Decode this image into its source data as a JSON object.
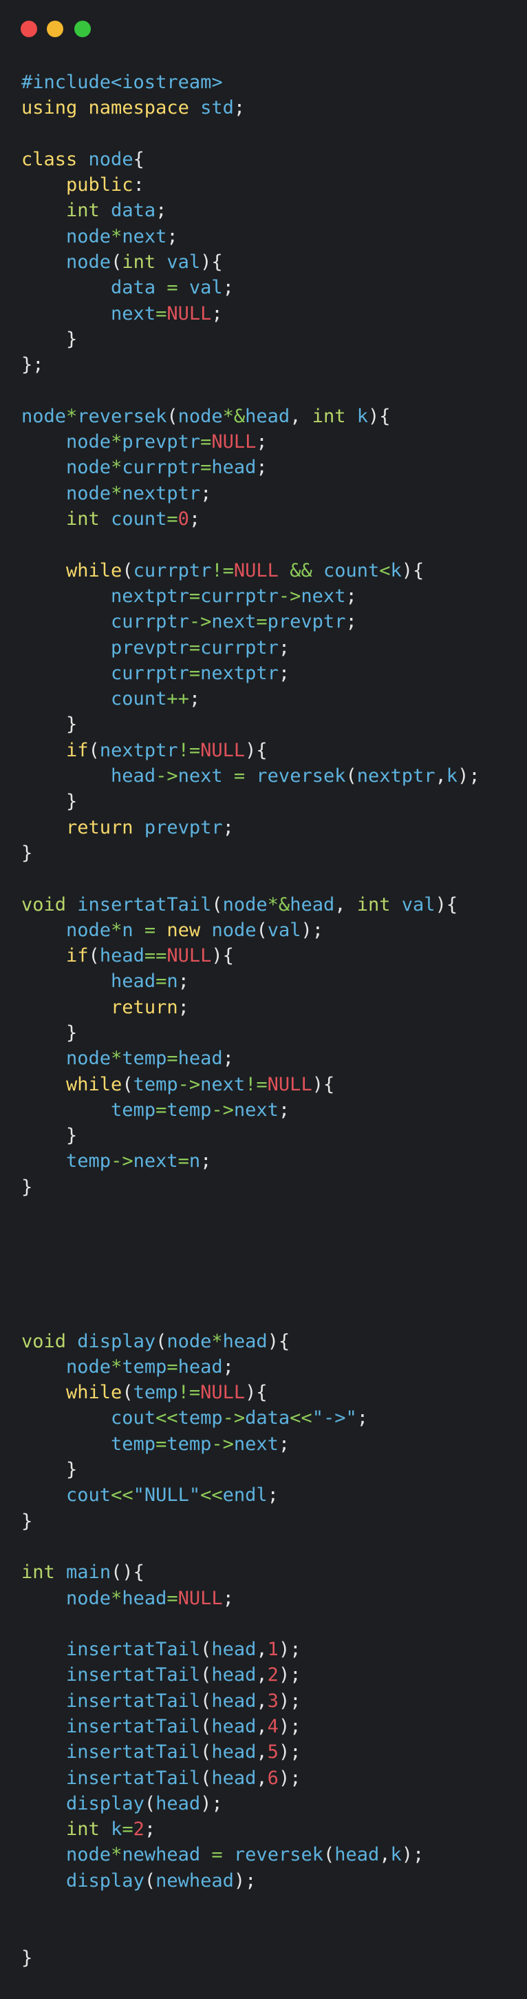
{
  "window": {
    "controls": [
      {
        "name": "close",
        "color": "#ef4b4b"
      },
      {
        "name": "minimize",
        "color": "#f3b82f"
      },
      {
        "name": "maximize",
        "color": "#37c53e"
      }
    ]
  },
  "colors": {
    "background": "#1c1e21",
    "plain": "#e6e6e6",
    "keyword": "#f6d86b",
    "type": "#b8d66a",
    "ident": "#5eb3e0",
    "operator": "#8ecb5a",
    "number": "#e0525a",
    "null": "#e0525a",
    "preprocessor": "#5eb3e0",
    "string": "#5eb3e0"
  },
  "code_lines": [
    [
      [
        "pp",
        "#include<iostream>"
      ]
    ],
    [
      [
        "kw",
        "using namespace"
      ],
      [
        "pl",
        " "
      ],
      [
        "id",
        "std"
      ],
      [
        "pl",
        ";"
      ]
    ],
    [],
    [
      [
        "kw",
        "class"
      ],
      [
        "pl",
        " "
      ],
      [
        "id",
        "node"
      ],
      [
        "pl",
        "{"
      ]
    ],
    [
      [
        "pl",
        "    "
      ],
      [
        "kw",
        "public"
      ],
      [
        "pl",
        ":"
      ]
    ],
    [
      [
        "pl",
        "    "
      ],
      [
        "ty",
        "int"
      ],
      [
        "pl",
        " "
      ],
      [
        "id",
        "data"
      ],
      [
        "pl",
        ";"
      ]
    ],
    [
      [
        "pl",
        "    "
      ],
      [
        "id",
        "node"
      ],
      [
        "op",
        "*"
      ],
      [
        "id",
        "next"
      ],
      [
        "pl",
        ";"
      ]
    ],
    [
      [
        "pl",
        "    "
      ],
      [
        "id",
        "node"
      ],
      [
        "pl",
        "("
      ],
      [
        "ty",
        "int"
      ],
      [
        "pl",
        " "
      ],
      [
        "id",
        "val"
      ],
      [
        "pl",
        "){"
      ]
    ],
    [
      [
        "pl",
        "        "
      ],
      [
        "id",
        "data"
      ],
      [
        "pl",
        " "
      ],
      [
        "op",
        "="
      ],
      [
        "pl",
        " "
      ],
      [
        "id",
        "val"
      ],
      [
        "pl",
        ";"
      ]
    ],
    [
      [
        "pl",
        "        "
      ],
      [
        "id",
        "next"
      ],
      [
        "op",
        "="
      ],
      [
        "nu",
        "NULL"
      ],
      [
        "pl",
        ";"
      ]
    ],
    [
      [
        "pl",
        "    }"
      ]
    ],
    [
      [
        "pl",
        "};"
      ]
    ],
    [],
    [
      [
        "id",
        "node"
      ],
      [
        "op",
        "*"
      ],
      [
        "id",
        "reversek"
      ],
      [
        "pl",
        "("
      ],
      [
        "id",
        "node"
      ],
      [
        "op",
        "*&"
      ],
      [
        "id",
        "head"
      ],
      [
        "pl",
        ", "
      ],
      [
        "ty",
        "int"
      ],
      [
        "pl",
        " "
      ],
      [
        "id",
        "k"
      ],
      [
        "pl",
        "){"
      ]
    ],
    [
      [
        "pl",
        "    "
      ],
      [
        "id",
        "node"
      ],
      [
        "op",
        "*"
      ],
      [
        "id",
        "prevptr"
      ],
      [
        "op",
        "="
      ],
      [
        "nu",
        "NULL"
      ],
      [
        "pl",
        ";"
      ]
    ],
    [
      [
        "pl",
        "    "
      ],
      [
        "id",
        "node"
      ],
      [
        "op",
        "*"
      ],
      [
        "id",
        "currptr"
      ],
      [
        "op",
        "="
      ],
      [
        "id",
        "head"
      ],
      [
        "pl",
        ";"
      ]
    ],
    [
      [
        "pl",
        "    "
      ],
      [
        "id",
        "node"
      ],
      [
        "op",
        "*"
      ],
      [
        "id",
        "nextptr"
      ],
      [
        "pl",
        ";"
      ]
    ],
    [
      [
        "pl",
        "    "
      ],
      [
        "ty",
        "int"
      ],
      [
        "pl",
        " "
      ],
      [
        "id",
        "count"
      ],
      [
        "op",
        "="
      ],
      [
        "nu",
        "0"
      ],
      [
        "pl",
        ";"
      ]
    ],
    [],
    [
      [
        "pl",
        "    "
      ],
      [
        "kw",
        "while"
      ],
      [
        "pl",
        "("
      ],
      [
        "id",
        "currptr"
      ],
      [
        "op",
        "!="
      ],
      [
        "nu",
        "NULL"
      ],
      [
        "pl",
        " "
      ],
      [
        "op",
        "&&"
      ],
      [
        "pl",
        " "
      ],
      [
        "id",
        "count"
      ],
      [
        "op",
        "<"
      ],
      [
        "id",
        "k"
      ],
      [
        "pl",
        "){"
      ]
    ],
    [
      [
        "pl",
        "        "
      ],
      [
        "id",
        "nextptr"
      ],
      [
        "op",
        "="
      ],
      [
        "id",
        "currptr"
      ],
      [
        "op",
        "->"
      ],
      [
        "id",
        "next"
      ],
      [
        "pl",
        ";"
      ]
    ],
    [
      [
        "pl",
        "        "
      ],
      [
        "id",
        "currptr"
      ],
      [
        "op",
        "->"
      ],
      [
        "id",
        "next"
      ],
      [
        "op",
        "="
      ],
      [
        "id",
        "prevptr"
      ],
      [
        "pl",
        ";"
      ]
    ],
    [
      [
        "pl",
        "        "
      ],
      [
        "id",
        "prevptr"
      ],
      [
        "op",
        "="
      ],
      [
        "id",
        "currptr"
      ],
      [
        "pl",
        ";"
      ]
    ],
    [
      [
        "pl",
        "        "
      ],
      [
        "id",
        "currptr"
      ],
      [
        "op",
        "="
      ],
      [
        "id",
        "nextptr"
      ],
      [
        "pl",
        ";"
      ]
    ],
    [
      [
        "pl",
        "        "
      ],
      [
        "id",
        "count"
      ],
      [
        "op",
        "++"
      ],
      [
        "pl",
        ";"
      ]
    ],
    [
      [
        "pl",
        "    }"
      ]
    ],
    [
      [
        "pl",
        "    "
      ],
      [
        "kw",
        "if"
      ],
      [
        "pl",
        "("
      ],
      [
        "id",
        "nextptr"
      ],
      [
        "op",
        "!="
      ],
      [
        "nu",
        "NULL"
      ],
      [
        "pl",
        "){"
      ]
    ],
    [
      [
        "pl",
        "        "
      ],
      [
        "id",
        "head"
      ],
      [
        "op",
        "->"
      ],
      [
        "id",
        "next"
      ],
      [
        "pl",
        " "
      ],
      [
        "op",
        "="
      ],
      [
        "pl",
        " "
      ],
      [
        "id",
        "reversek"
      ],
      [
        "pl",
        "("
      ],
      [
        "id",
        "nextptr"
      ],
      [
        "pl",
        ","
      ],
      [
        "id",
        "k"
      ],
      [
        "pl",
        ");"
      ]
    ],
    [
      [
        "pl",
        "    }"
      ]
    ],
    [
      [
        "pl",
        "    "
      ],
      [
        "kw",
        "return"
      ],
      [
        "pl",
        " "
      ],
      [
        "id",
        "prevptr"
      ],
      [
        "pl",
        ";"
      ]
    ],
    [
      [
        "pl",
        "}"
      ]
    ],
    [],
    [
      [
        "ty",
        "void"
      ],
      [
        "pl",
        " "
      ],
      [
        "id",
        "insertatTail"
      ],
      [
        "pl",
        "("
      ],
      [
        "id",
        "node"
      ],
      [
        "op",
        "*&"
      ],
      [
        "id",
        "head"
      ],
      [
        "pl",
        ", "
      ],
      [
        "ty",
        "int"
      ],
      [
        "pl",
        " "
      ],
      [
        "id",
        "val"
      ],
      [
        "pl",
        "){"
      ]
    ],
    [
      [
        "pl",
        "    "
      ],
      [
        "id",
        "node"
      ],
      [
        "op",
        "*"
      ],
      [
        "id",
        "n"
      ],
      [
        "pl",
        " "
      ],
      [
        "op",
        "="
      ],
      [
        "pl",
        " "
      ],
      [
        "kw",
        "new"
      ],
      [
        "pl",
        " "
      ],
      [
        "id",
        "node"
      ],
      [
        "pl",
        "("
      ],
      [
        "id",
        "val"
      ],
      [
        "pl",
        ");"
      ]
    ],
    [
      [
        "pl",
        "    "
      ],
      [
        "kw",
        "if"
      ],
      [
        "pl",
        "("
      ],
      [
        "id",
        "head"
      ],
      [
        "op",
        "=="
      ],
      [
        "nu",
        "NULL"
      ],
      [
        "pl",
        "){"
      ]
    ],
    [
      [
        "pl",
        "        "
      ],
      [
        "id",
        "head"
      ],
      [
        "op",
        "="
      ],
      [
        "id",
        "n"
      ],
      [
        "pl",
        ";"
      ]
    ],
    [
      [
        "pl",
        "        "
      ],
      [
        "kw",
        "return"
      ],
      [
        "pl",
        ";"
      ]
    ],
    [
      [
        "pl",
        "    }"
      ]
    ],
    [
      [
        "pl",
        "    "
      ],
      [
        "id",
        "node"
      ],
      [
        "op",
        "*"
      ],
      [
        "id",
        "temp"
      ],
      [
        "op",
        "="
      ],
      [
        "id",
        "head"
      ],
      [
        "pl",
        ";"
      ]
    ],
    [
      [
        "pl",
        "    "
      ],
      [
        "kw",
        "while"
      ],
      [
        "pl",
        "("
      ],
      [
        "id",
        "temp"
      ],
      [
        "op",
        "->"
      ],
      [
        "id",
        "next"
      ],
      [
        "op",
        "!="
      ],
      [
        "nu",
        "NULL"
      ],
      [
        "pl",
        "){"
      ]
    ],
    [
      [
        "pl",
        "        "
      ],
      [
        "id",
        "temp"
      ],
      [
        "op",
        "="
      ],
      [
        "id",
        "temp"
      ],
      [
        "op",
        "->"
      ],
      [
        "id",
        "next"
      ],
      [
        "pl",
        ";"
      ]
    ],
    [
      [
        "pl",
        "    }"
      ]
    ],
    [
      [
        "pl",
        "    "
      ],
      [
        "id",
        "temp"
      ],
      [
        "op",
        "->"
      ],
      [
        "id",
        "next"
      ],
      [
        "op",
        "="
      ],
      [
        "id",
        "n"
      ],
      [
        "pl",
        ";"
      ]
    ],
    [
      [
        "pl",
        "}"
      ]
    ],
    [],
    [],
    [],
    [],
    [],
    [
      [
        "ty",
        "void"
      ],
      [
        "pl",
        " "
      ],
      [
        "id",
        "display"
      ],
      [
        "pl",
        "("
      ],
      [
        "id",
        "node"
      ],
      [
        "op",
        "*"
      ],
      [
        "id",
        "head"
      ],
      [
        "pl",
        "){"
      ]
    ],
    [
      [
        "pl",
        "    "
      ],
      [
        "id",
        "node"
      ],
      [
        "op",
        "*"
      ],
      [
        "id",
        "temp"
      ],
      [
        "op",
        "="
      ],
      [
        "id",
        "head"
      ],
      [
        "pl",
        ";"
      ]
    ],
    [
      [
        "pl",
        "    "
      ],
      [
        "kw",
        "while"
      ],
      [
        "pl",
        "("
      ],
      [
        "id",
        "temp"
      ],
      [
        "op",
        "!="
      ],
      [
        "nu",
        "NULL"
      ],
      [
        "pl",
        "){"
      ]
    ],
    [
      [
        "pl",
        "        "
      ],
      [
        "id",
        "cout"
      ],
      [
        "op",
        "<<"
      ],
      [
        "id",
        "temp"
      ],
      [
        "op",
        "->"
      ],
      [
        "id",
        "data"
      ],
      [
        "op",
        "<<"
      ],
      [
        "st",
        "\"->\""
      ],
      [
        "pl",
        ";"
      ]
    ],
    [
      [
        "pl",
        "        "
      ],
      [
        "id",
        "temp"
      ],
      [
        "op",
        "="
      ],
      [
        "id",
        "temp"
      ],
      [
        "op",
        "->"
      ],
      [
        "id",
        "next"
      ],
      [
        "pl",
        ";"
      ]
    ],
    [
      [
        "pl",
        "    }"
      ]
    ],
    [
      [
        "pl",
        "    "
      ],
      [
        "id",
        "cout"
      ],
      [
        "op",
        "<<"
      ],
      [
        "st",
        "\"NULL\""
      ],
      [
        "op",
        "<<"
      ],
      [
        "id",
        "endl"
      ],
      [
        "pl",
        ";"
      ]
    ],
    [
      [
        "pl",
        "}"
      ]
    ],
    [],
    [
      [
        "ty",
        "int"
      ],
      [
        "pl",
        " "
      ],
      [
        "id",
        "main"
      ],
      [
        "pl",
        "(){"
      ]
    ],
    [
      [
        "pl",
        "    "
      ],
      [
        "id",
        "node"
      ],
      [
        "op",
        "*"
      ],
      [
        "id",
        "head"
      ],
      [
        "op",
        "="
      ],
      [
        "nu",
        "NULL"
      ],
      [
        "pl",
        ";"
      ]
    ],
    [],
    [
      [
        "pl",
        "    "
      ],
      [
        "id",
        "insertatTail"
      ],
      [
        "pl",
        "("
      ],
      [
        "id",
        "head"
      ],
      [
        "pl",
        ","
      ],
      [
        "nu",
        "1"
      ],
      [
        "pl",
        ");"
      ]
    ],
    [
      [
        "pl",
        "    "
      ],
      [
        "id",
        "insertatTail"
      ],
      [
        "pl",
        "("
      ],
      [
        "id",
        "head"
      ],
      [
        "pl",
        ","
      ],
      [
        "nu",
        "2"
      ],
      [
        "pl",
        ");"
      ]
    ],
    [
      [
        "pl",
        "    "
      ],
      [
        "id",
        "insertatTail"
      ],
      [
        "pl",
        "("
      ],
      [
        "id",
        "head"
      ],
      [
        "pl",
        ","
      ],
      [
        "nu",
        "3"
      ],
      [
        "pl",
        ");"
      ]
    ],
    [
      [
        "pl",
        "    "
      ],
      [
        "id",
        "insertatTail"
      ],
      [
        "pl",
        "("
      ],
      [
        "id",
        "head"
      ],
      [
        "pl",
        ","
      ],
      [
        "nu",
        "4"
      ],
      [
        "pl",
        ");"
      ]
    ],
    [
      [
        "pl",
        "    "
      ],
      [
        "id",
        "insertatTail"
      ],
      [
        "pl",
        "("
      ],
      [
        "id",
        "head"
      ],
      [
        "pl",
        ","
      ],
      [
        "nu",
        "5"
      ],
      [
        "pl",
        ");"
      ]
    ],
    [
      [
        "pl",
        "    "
      ],
      [
        "id",
        "insertatTail"
      ],
      [
        "pl",
        "("
      ],
      [
        "id",
        "head"
      ],
      [
        "pl",
        ","
      ],
      [
        "nu",
        "6"
      ],
      [
        "pl",
        ");"
      ]
    ],
    [
      [
        "pl",
        "    "
      ],
      [
        "id",
        "display"
      ],
      [
        "pl",
        "("
      ],
      [
        "id",
        "head"
      ],
      [
        "pl",
        ");"
      ]
    ],
    [
      [
        "pl",
        "    "
      ],
      [
        "ty",
        "int"
      ],
      [
        "pl",
        " "
      ],
      [
        "id",
        "k"
      ],
      [
        "op",
        "="
      ],
      [
        "nu",
        "2"
      ],
      [
        "pl",
        ";"
      ]
    ],
    [
      [
        "pl",
        "    "
      ],
      [
        "id",
        "node"
      ],
      [
        "op",
        "*"
      ],
      [
        "id",
        "newhead"
      ],
      [
        "pl",
        " "
      ],
      [
        "op",
        "="
      ],
      [
        "pl",
        " "
      ],
      [
        "id",
        "reversek"
      ],
      [
        "pl",
        "("
      ],
      [
        "id",
        "head"
      ],
      [
        "pl",
        ","
      ],
      [
        "id",
        "k"
      ],
      [
        "pl",
        ");"
      ]
    ],
    [
      [
        "pl",
        "    "
      ],
      [
        "id",
        "display"
      ],
      [
        "pl",
        "("
      ],
      [
        "id",
        "newhead"
      ],
      [
        "pl",
        ");"
      ]
    ],
    [],
    [],
    [
      [
        "pl",
        "}"
      ]
    ]
  ]
}
